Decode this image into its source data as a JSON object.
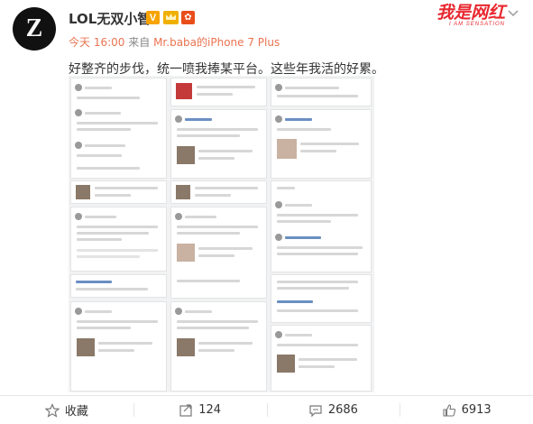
{
  "header": {
    "username": "LOL无双小智",
    "vip_badge": "V",
    "medal_badge": "✿",
    "time": "今天 16:00",
    "via_prefix": "来自",
    "device": "Mr.baba的iPhone 7 Plus",
    "watermark_big": "我是网红",
    "watermark_small": "I AM SENSATION"
  },
  "post": {
    "text": "好整齐的步伐，统一喷我捧某平台。这些年我活的好累。"
  },
  "actions": {
    "favorite_label": "收藏",
    "repost_count": "124",
    "comment_count": "2686",
    "like_count": "6913"
  },
  "icons": {
    "favorite": "star-outline-icon",
    "repost": "repost-icon",
    "comment": "comment-icon",
    "like": "thumbs-up-icon",
    "menu": "chevron-down-icon"
  },
  "colors": {
    "accent_orange": "#eb7350",
    "watermark_red": "#e8272e",
    "text": "#333333",
    "muted": "#888888"
  }
}
